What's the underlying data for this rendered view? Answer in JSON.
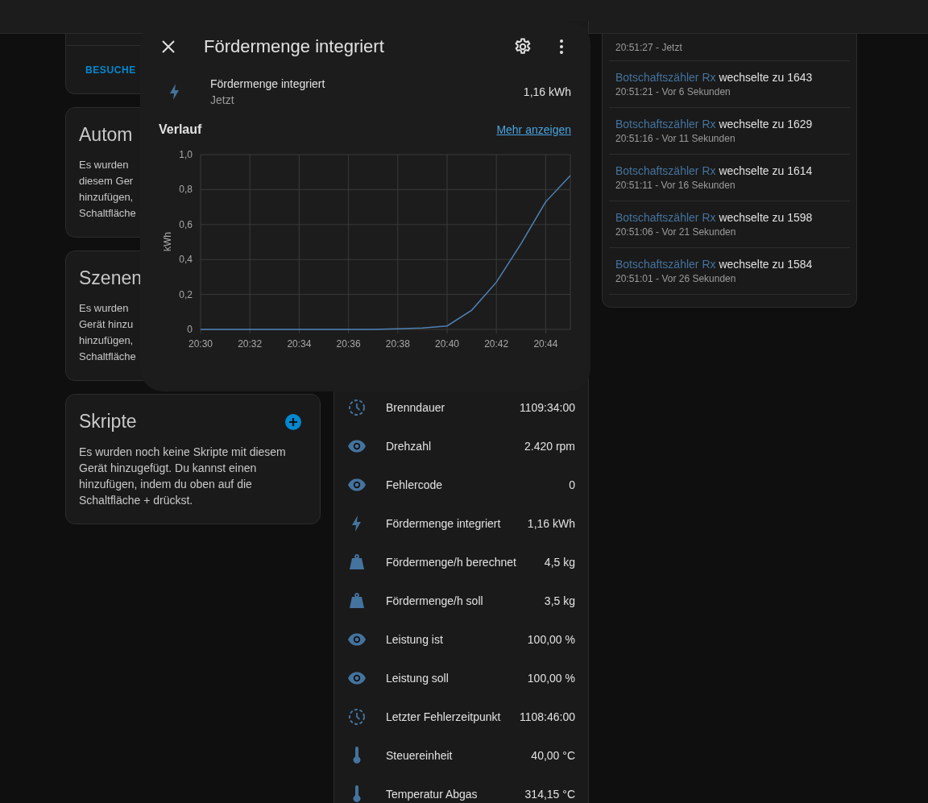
{
  "left_cards": [
    {
      "kind": "actions",
      "button": "BESUCHE"
    },
    {
      "kind": "info",
      "title": "Autom",
      "lines": [
        "Es wurden",
        "diesem Ger",
        "hinzufügen,",
        "Schaltfläche"
      ],
      "add_button": false
    },
    {
      "kind": "info",
      "title": "Szenen",
      "lines": [
        "Es wurden",
        "Gerät hinzu",
        "hinzufügen,",
        "Schaltfläche"
      ],
      "add_button": false
    },
    {
      "kind": "info",
      "title": "Skripte",
      "lines": [
        "Es wurden noch keine Skripte mit diesem Gerät hinzugefügt. Du kannst einen hinzufügen, indem du oben auf die Schaltfläche + drückst."
      ],
      "add_button": true
    }
  ],
  "entities": [
    {
      "kind": "clock",
      "name": "Brenndauer",
      "value": "1109:34:00"
    },
    {
      "kind": "eye",
      "name": "Drehzahl",
      "value": "2.420 rpm"
    },
    {
      "kind": "eye",
      "name": "Fehlercode",
      "value": "0"
    },
    {
      "kind": "bolt",
      "name": "Fördermenge integriert",
      "value": "1,16 kWh"
    },
    {
      "kind": "weight",
      "name": "Fördermenge/h berechnet",
      "value": "4,5 kg"
    },
    {
      "kind": "weight",
      "name": "Fördermenge/h soll",
      "value": "3,5 kg"
    },
    {
      "kind": "eye",
      "name": "Leistung ist",
      "value": "100,00 %"
    },
    {
      "kind": "eye",
      "name": "Leistung soll",
      "value": "100,00 %"
    },
    {
      "kind": "clock",
      "name": "Letzter Fehlerzeitpunkt",
      "value": "1108:46:00"
    },
    {
      "kind": "thermometer",
      "name": "Steuereinheit",
      "value": "40,00 °C"
    },
    {
      "kind": "thermometer",
      "name": "Temperatur Abgas",
      "value": "314,15 °C"
    }
  ],
  "logbook": [
    {
      "time": "20:51:27 - Jetzt"
    },
    {
      "entity": "Botschaftszähler Rx",
      "message": "wechselte zu 1643",
      "time": "20:51:21 - Vor 6 Sekunden"
    },
    {
      "entity": "Botschaftszähler Rx",
      "message": "wechselte zu 1629",
      "time": "20:51:16 - Vor 11 Sekunden"
    },
    {
      "entity": "Botschaftszähler Rx",
      "message": "wechselte zu 1614",
      "time": "20:51:11 - Vor 16 Sekunden"
    },
    {
      "entity": "Botschaftszähler Rx",
      "message": "wechselte zu 1598",
      "time": "20:51:06 - Vor 21 Sekunden"
    },
    {
      "entity": "Botschaftszähler Rx",
      "message": "wechselte zu 1584",
      "time": "20:51:01 - Vor 26 Sekunden"
    }
  ],
  "dialog": {
    "title": "Fördermenge integriert",
    "entity": {
      "kind": "bolt",
      "name": "Fördermenge integriert",
      "time": "Jetzt",
      "value": "1,16 kWh"
    },
    "history_title": "Verlauf",
    "more_link": "Mehr anzeigen",
    "chart_data": {
      "type": "line",
      "ylabel": "kWh",
      "categories": [
        "20:30",
        null,
        "20:32",
        null,
        "20:34",
        null,
        "20:36",
        null,
        "20:38",
        null,
        "20:40",
        null,
        "20:42",
        null,
        "20:44",
        null
      ],
      "series": [
        {
          "color": "#4f82b5",
          "values": [
            0,
            0,
            0,
            0,
            0,
            0,
            0,
            0,
            0.003,
            0.008,
            0.02,
            0.11,
            0.27,
            0.49,
            0.73,
            0.88
          ]
        }
      ],
      "ylim": [
        0,
        1
      ],
      "grid": true,
      "yticks": [
        {
          "value": 0,
          "label": "0"
        },
        {
          "value": 0.2,
          "label": "0,2"
        },
        {
          "value": 0.4,
          "label": "0,4"
        },
        {
          "value": 0.6,
          "label": "0,6"
        },
        {
          "value": 0.8,
          "label": "0,8"
        },
        {
          "value": 1,
          "label": "1,0"
        }
      ]
    }
  }
}
